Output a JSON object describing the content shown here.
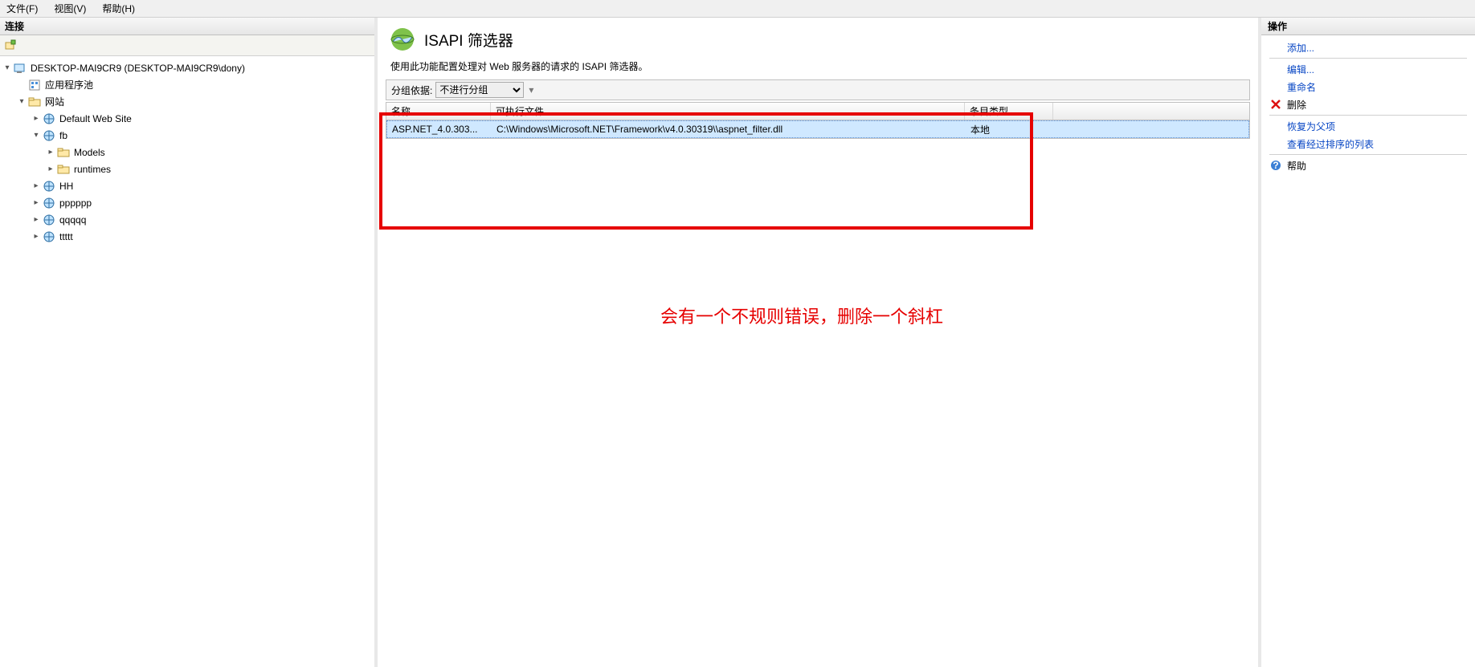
{
  "menu": {
    "file": "文件(F)",
    "view": "视图(V)",
    "help": "帮助(H)"
  },
  "left": {
    "header": "连接",
    "root": "DESKTOP-MAI9CR9 (DESKTOP-MAI9CR9\\dony)",
    "app_pools": "应用程序池",
    "sites": "网站",
    "default_site": "Default Web Site",
    "fb": "fb",
    "models": "Models",
    "runtimes": "runtimes",
    "hh": "HH",
    "pppppp": "pppppp",
    "qqqqq": "qqqqq",
    "ttttt": "ttttt"
  },
  "center": {
    "title": "ISAPI 筛选器",
    "desc": "使用此功能配置处理对 Web 服务器的请求的 ISAPI 筛选器。",
    "group_label": "分组依据:",
    "group_value": "不进行分组",
    "col_name": "名称",
    "col_exe": "可执行文件",
    "col_type": "条目类型",
    "row": {
      "name": "ASP.NET_4.0.303...",
      "exe": "C:\\Windows\\Microsoft.NET\\Framework\\v4.0.30319\\\\aspnet_filter.dll",
      "type": "本地"
    },
    "annotation": "会有一个不规则错误，删除一个斜杠"
  },
  "actions": {
    "header": "操作",
    "add": "添加...",
    "edit": "编辑...",
    "rename": "重命名",
    "delete": "删除",
    "revert": "恢复为父项",
    "view_ordered": "查看经过排序的列表",
    "help": "帮助"
  }
}
